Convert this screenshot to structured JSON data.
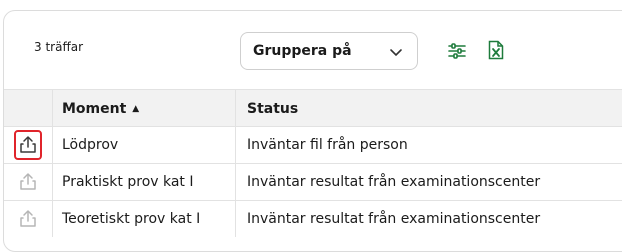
{
  "toolbar": {
    "hits_label": "3 träffar",
    "group_by_label": "Gruppera på",
    "icons": [
      "sliders-icon",
      "excel-export-icon"
    ]
  },
  "table": {
    "columns": [
      "Moment",
      "Status"
    ],
    "sort_column": "Moment",
    "sort_direction": "ascending",
    "rows": [
      {
        "moment": "Lödprov",
        "status": "Inväntar fil från person",
        "upload_active": true
      },
      {
        "moment": "Praktiskt prov kat I",
        "status": "Inväntar resultat från examinationscenter",
        "upload_active": false
      },
      {
        "moment": "Teoretiskt prov kat I",
        "status": "Inväntar resultat från examinationscenter",
        "upload_active": false
      }
    ]
  },
  "colors": {
    "excel_green": "#1e7b3c",
    "highlight_red": "#e0242b",
    "header_bg": "#f2f2f2"
  }
}
